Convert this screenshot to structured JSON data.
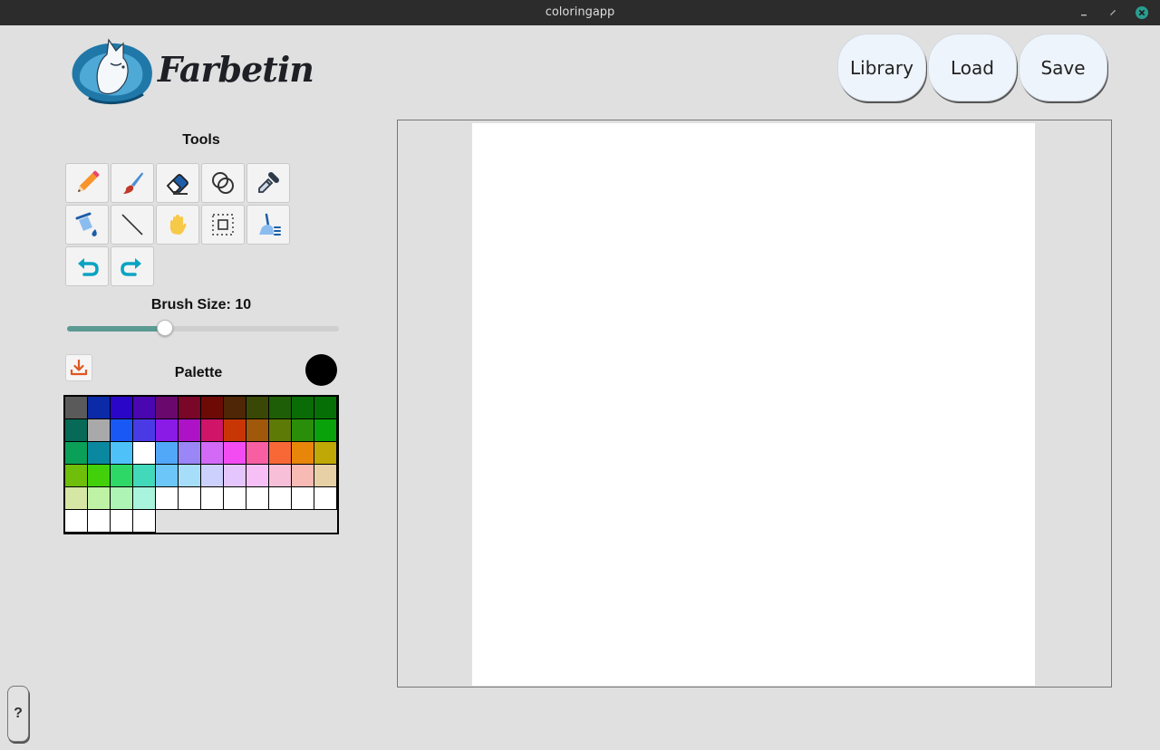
{
  "window": {
    "title": "coloringapp"
  },
  "brand": {
    "name": "Farbetin"
  },
  "header": {
    "buttons": {
      "library": "Library",
      "load": "Load",
      "save": "Save"
    }
  },
  "tools": {
    "title": "Tools",
    "items": [
      "pencil-icon",
      "brush-icon",
      "eraser-icon",
      "shapes-icon",
      "eyedropper-icon",
      "fill-bucket-icon",
      "line-icon",
      "hand-icon",
      "select-icon",
      "clear-icon",
      "undo-icon",
      "redo-icon"
    ]
  },
  "brush": {
    "label": "Brush Size: 10",
    "value": 10,
    "min": 1,
    "max": 100
  },
  "palette": {
    "title": "Palette",
    "current_color": "#000000",
    "colors": [
      "#5a5a5a",
      "#0a2aa8",
      "#2a06c8",
      "#4a06b0",
      "#6a086e",
      "#7a0628",
      "#6e0a06",
      "#4f2606",
      "#3a4806",
      "#1e5e06",
      "#0a6c06",
      "#067006",
      "#066a56",
      "#a9a9a9",
      "#1a58f6",
      "#4a3ae6",
      "#8a1ae6",
      "#ae12c6",
      "#d01468",
      "#c83606",
      "#a0580a",
      "#5e7a06",
      "#2a8e0a",
      "#0aa20a",
      "#0aa058",
      "#0a88a0",
      "#4ec2f8",
      "#ffffff",
      "#52a8f8",
      "#9a86f6",
      "#d26af6",
      "#f24cf2",
      "#f85ea2",
      "#f86836",
      "#e8860a",
      "#c0a806",
      "#6ebe0a",
      "#42d00a",
      "#2ed866",
      "#42d8ba",
      "#6cc6f8",
      "#a6ddf8",
      "#ccd0fc",
      "#e4c6fc",
      "#f6c0f6",
      "#f8c0d8",
      "#f8bab4",
      "#e8d0a6",
      "#d6e6a4",
      "#bef2a4",
      "#aef4b4",
      "#a8f4dc",
      "#ffffff",
      "#ffffff",
      "#ffffff",
      "#ffffff",
      "#ffffff",
      "#ffffff",
      "#ffffff",
      "#ffffff",
      "#ffffff",
      "#ffffff",
      "#ffffff",
      "#ffffff"
    ]
  },
  "help": {
    "label": "?"
  },
  "colors": {
    "titlebar": "#2c2c2c",
    "background": "#e0e0e0",
    "button_bg": "#eef4fb",
    "accent_teal": "#5a9a92",
    "close_green": "#2a9d8f"
  }
}
